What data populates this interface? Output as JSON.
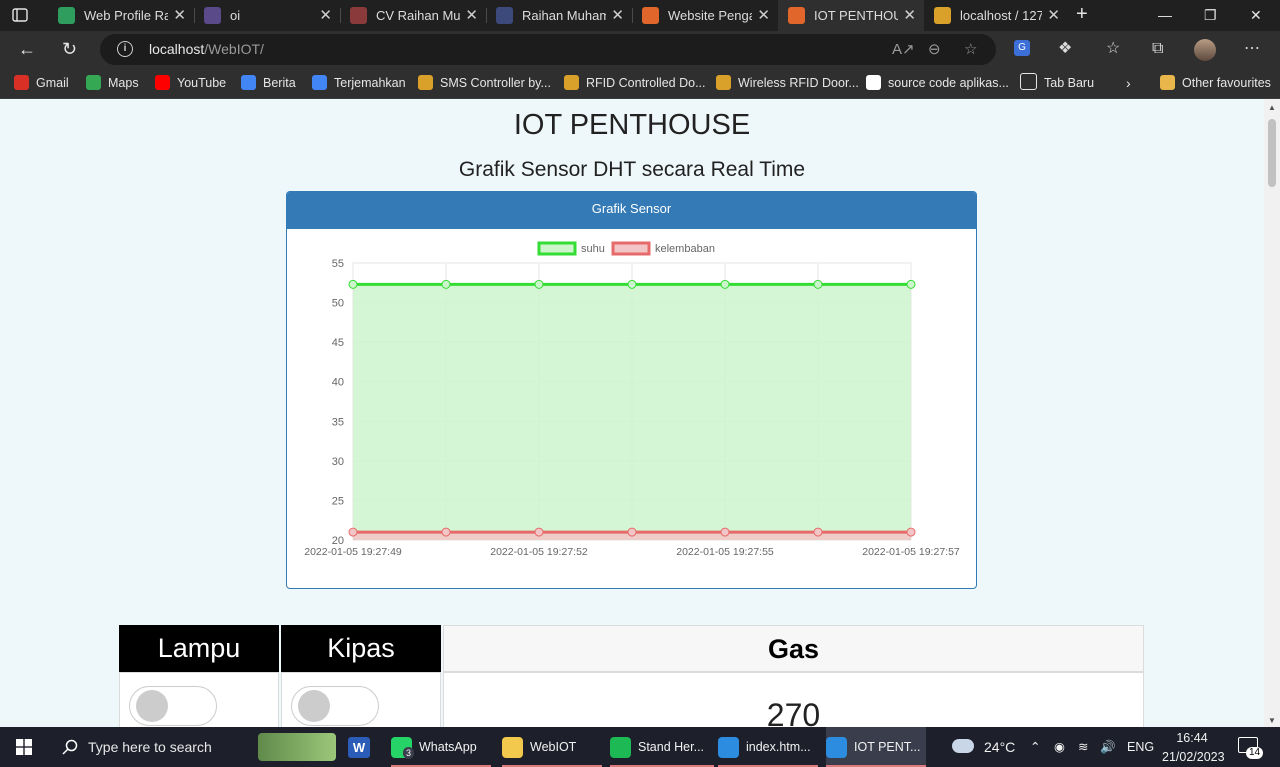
{
  "browser": {
    "tabs": [
      {
        "title": "Web Profile Ra",
        "color": "#2e9d5e",
        "active": false
      },
      {
        "title": "oi",
        "color": "#5b4a8a",
        "active": false
      },
      {
        "title": "CV Raihan Muh",
        "color": "#8a3a3a",
        "active": false
      },
      {
        "title": "Raihan Muham",
        "color": "#3b4a7a",
        "active": false
      },
      {
        "title": "Website Penga",
        "color": "#e0662b",
        "active": false
      },
      {
        "title": "IOT PENTHOUS",
        "color": "#e0662b",
        "active": true
      },
      {
        "title": "localhost / 127",
        "color": "#d9a12a",
        "active": false
      }
    ],
    "url_host": "localhost",
    "url_path": "/WebIOT/",
    "bookmarks": [
      {
        "label": "Gmail",
        "color": "#d93025"
      },
      {
        "label": "Maps",
        "color": "#34a853"
      },
      {
        "label": "YouTube",
        "color": "#ff0000"
      },
      {
        "label": "Berita",
        "color": "#4285f4"
      },
      {
        "label": "Terjemahkan",
        "color": "#4285f4"
      },
      {
        "label": "SMS Controller by...",
        "color": "#d9a12a"
      },
      {
        "label": "RFID Controlled Do...",
        "color": "#d9a12a"
      },
      {
        "label": "Wireless RFID Door...",
        "color": "#d9a12a"
      },
      {
        "label": "source code aplikas...",
        "color": "#ffffff"
      },
      {
        "label": "Tab Baru",
        "color": "#2f2f2f"
      }
    ],
    "other_favourites": "Other favourites"
  },
  "page": {
    "title": "IOT PENTHOUSE",
    "subtitle": "Grafik Sensor DHT secara Real Time",
    "panel_title": "Grafik Sensor",
    "table": {
      "lampu": "Lampu",
      "kipas": "Kipas",
      "gas": "Gas",
      "gas_value": "270"
    }
  },
  "chart_data": {
    "type": "line",
    "title": "",
    "x": [
      "2022-01-05 19:27:49",
      "",
      "2022-01-05 19:27:52",
      "",
      "2022-01-05 19:27:55",
      "",
      "2022-01-05 19:27:57"
    ],
    "x_tick_labels": [
      "2022-01-05 19:27:49",
      "2022-01-05 19:27:52",
      "2022-01-05 19:27:55",
      "2022-01-05 19:27:57"
    ],
    "y_ticks": [
      "55",
      "50",
      "45",
      "40",
      "35",
      "30",
      "25",
      "20"
    ],
    "ylim": [
      20,
      55
    ],
    "legend_position": "top",
    "grid": true,
    "series": [
      {
        "name": "suhu",
        "values": [
          52.3,
          52.3,
          52.3,
          52.3,
          52.3,
          52.3,
          52.3
        ],
        "color": "#33dd33",
        "fill": "#ccf5cc"
      },
      {
        "name": "kelembaban",
        "values": [
          21,
          21,
          21,
          21,
          21,
          21,
          21
        ],
        "color": "#e66a6a",
        "fill": "#f2c6c6"
      }
    ]
  },
  "taskbar": {
    "search_placeholder": "Type here to search",
    "apps": [
      {
        "label": "WhatsApp",
        "color": "#25d366",
        "badge": "3"
      },
      {
        "label": "WebIOT",
        "color": "#f2c94c"
      },
      {
        "label": "Stand Her...",
        "color": "#1db954"
      },
      {
        "label": "index.htm...",
        "color": "#2b8ce0"
      },
      {
        "label": "IOT PENT...",
        "color": "#2b8ce0"
      }
    ],
    "weather": "24°C",
    "lang": "ENG",
    "time": "16:44",
    "date": "21/02/2023",
    "notifications": "14"
  }
}
